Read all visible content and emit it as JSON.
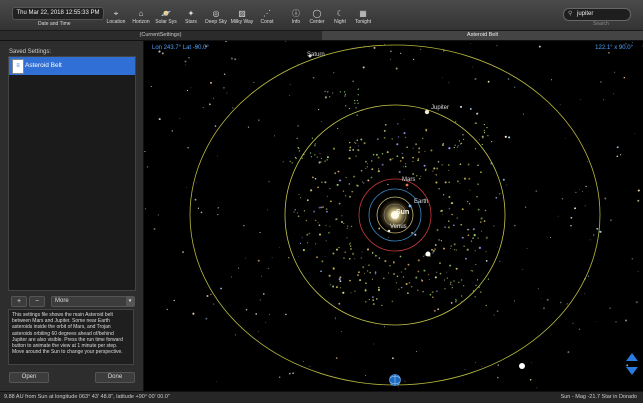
{
  "toolbar": {
    "datetime": "Thu Mar 22, 2018 12:55:33 PM",
    "datetime_label": "Date and Time",
    "buttons": [
      {
        "label": "Location",
        "icon": "location-pin-icon"
      },
      {
        "label": "Horizon",
        "icon": "horizon-icon"
      },
      {
        "label": "Solar Sys",
        "icon": "solar-system-icon"
      },
      {
        "label": "Stars",
        "icon": "stars-icon"
      },
      {
        "label": "Deep Sky",
        "icon": "galaxy-icon"
      },
      {
        "label": "Milky Way",
        "icon": "milky-way-icon"
      },
      {
        "label": "Const",
        "icon": "constellation-icon"
      },
      {
        "label": "Info",
        "icon": "info-icon"
      },
      {
        "label": "Center",
        "icon": "center-icon"
      },
      {
        "label": "Night",
        "icon": "moon-icon"
      },
      {
        "label": "Tonight",
        "icon": "calendar-icon"
      }
    ],
    "search_value": "jupiter",
    "search_label": "Search"
  },
  "tabs": [
    {
      "label": "(CurrentSettings)"
    },
    {
      "label": "Asteroid Belt"
    }
  ],
  "sidebar": {
    "title": "Saved Settings:",
    "items": [
      {
        "label": "Asteroid Belt"
      }
    ],
    "add_label": "+",
    "remove_label": "−",
    "more_label": "More",
    "description": "This settings file shows the main Asteroid belt between Mars and Jupiter.  Some near Earth asteroids inside the orbit of Mars, and Trojan asteroids orbiting 60 degrees ahead of/behind Jupiter are also visible.  Press the run time forward button to animate the view at 1 minute per step.  Move around the Sun to change your perspective.",
    "open_label": "Open",
    "done_label": "Done"
  },
  "view": {
    "lonlat": "Lon 243.7° Lat -90.0°",
    "fov": "122.1° x 90.0°",
    "planets": [
      "Saturn",
      "Jupiter",
      "Mars",
      "Earth",
      "Sun",
      "Venus"
    ]
  },
  "status": {
    "left": "9.88 AU from Sun at longitude 063° 43' 48.8\", latitude +90° 00' 00.0\"",
    "right": "Sun - Mag -21.7 Star in Dorado"
  },
  "colors": {
    "accent": "#2f6fd6",
    "coord_text": "#4aa3ff",
    "orbit_yellow": "#c8c84a",
    "orbit_red": "#c83c3c"
  }
}
